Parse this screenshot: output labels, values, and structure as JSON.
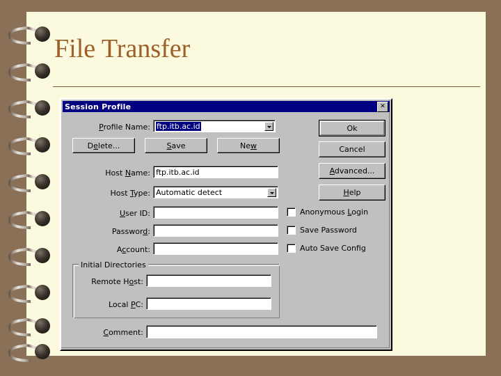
{
  "slide": {
    "title": "File Transfer",
    "title_color": "#9c5f2a",
    "page_color": "#fcfade",
    "border_color": "#8a7057"
  },
  "dialog": {
    "titlebar": {
      "title": "Session Profile",
      "close_label": "✕",
      "bg_color": "#000080"
    },
    "profile_name": {
      "label": "Profile Name:",
      "label_pre": "P",
      "label_accel": "r",
      "label_post": "ofile Name:",
      "value": "ftp.itb.ac.id",
      "selected": true
    },
    "buttons_row": [
      {
        "id": "delete",
        "pre": "D",
        "accel": "e",
        "post": "lete...",
        "label": "Delete..."
      },
      {
        "id": "save",
        "pre": "",
        "accel": "S",
        "post": "ave",
        "label": "Save"
      },
      {
        "id": "new",
        "pre": "Ne",
        "accel": "w",
        "post": "",
        "label": "New"
      }
    ],
    "right_buttons": [
      {
        "id": "ok",
        "pre": "",
        "accel": "",
        "post": "Ok",
        "label": "Ok",
        "default": true
      },
      {
        "id": "cancel",
        "pre": "",
        "accel": "",
        "post": "Cancel",
        "label": "Cancel",
        "default": false
      },
      {
        "id": "advanced",
        "pre": "",
        "accel": "A",
        "post": "dvanced...",
        "label": "Advanced...",
        "default": false
      },
      {
        "id": "help",
        "pre": "",
        "accel": "H",
        "post": "elp",
        "label": "Help",
        "default": false
      }
    ],
    "host_name": {
      "label_pre": "Host ",
      "label_accel": "N",
      "label_post": "ame:",
      "value": "ftp.itb.ac.id",
      "placeholder": ""
    },
    "host_type": {
      "label_pre": "Host ",
      "label_accel": "T",
      "label_post": "ype:",
      "value": "Automatic detect",
      "options": [
        "Automatic detect"
      ]
    },
    "user_id": {
      "label_pre": "",
      "label_accel": "U",
      "label_post": "ser ID:",
      "value": "",
      "placeholder": ""
    },
    "password": {
      "label_pre": "Passwor",
      "label_accel": "d",
      "label_post": ":",
      "value": "",
      "placeholder": ""
    },
    "account": {
      "label_pre": "A",
      "label_accel": "c",
      "label_post": "count:",
      "value": "",
      "placeholder": ""
    },
    "checkboxes": [
      {
        "id": "anonymous-login",
        "pre": "Anonymous ",
        "accel": "L",
        "post": "ogin",
        "label": "Anonymous Login",
        "checked": false
      },
      {
        "id": "save-password",
        "pre": "Save Password",
        "accel": "",
        "post": "",
        "label": "Save Password",
        "checked": false
      },
      {
        "id": "auto-save-config",
        "pre": "Auto Save Config",
        "accel": "",
        "post": "",
        "label": "Auto Save Config",
        "checked": false
      }
    ],
    "initial_directories": {
      "group_label": "Initial Directories",
      "remote_host": {
        "label_pre": "Remote H",
        "label_accel": "o",
        "label_post": "st:",
        "value": "",
        "placeholder": ""
      },
      "local_pc": {
        "label_pre": "Local ",
        "label_accel": "P",
        "label_post": "C:",
        "value": "",
        "placeholder": ""
      }
    },
    "comment": {
      "label_pre": "",
      "label_accel": "C",
      "label_post": "omment:",
      "value": "",
      "placeholder": ""
    }
  }
}
